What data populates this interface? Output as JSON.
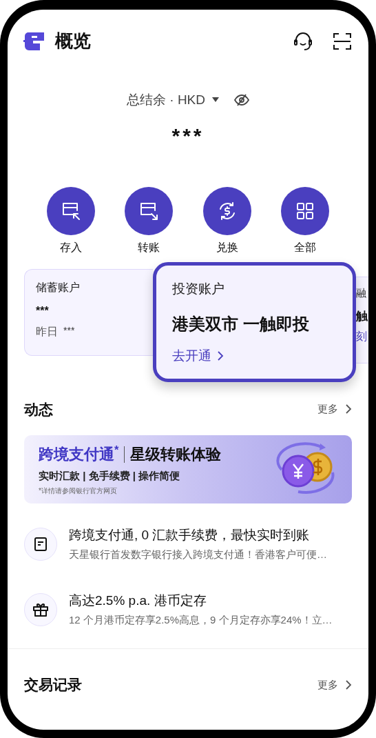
{
  "header": {
    "title": "概览"
  },
  "balance": {
    "label": "总结余 · HKD",
    "amount": "***",
    "hidden": true
  },
  "actions": [
    {
      "label": "存入",
      "kind": "deposit"
    },
    {
      "label": "转账",
      "kind": "transfer"
    },
    {
      "label": "兑换",
      "kind": "exchange"
    },
    {
      "label": "全部",
      "kind": "all"
    }
  ],
  "accounts": [
    {
      "title": "储蓄账户",
      "amount": "***",
      "yesterday_label": "昨日",
      "yesterday": "***"
    },
    {
      "title": "融",
      "line2": "触",
      "line3": "刻"
    }
  ],
  "popup_card": {
    "title": "投资账户",
    "headline": "港美双市 一触即投",
    "link": "去开通"
  },
  "feed": {
    "title": "动态",
    "more": "更多",
    "banner": {
      "title": "跨境支付通$^{*}$",
      "title2": "星级转账体验",
      "subtitle": "实时汇款 | 免手续费 | 操作简便",
      "note": "*详情请参阅银行官方网页"
    },
    "items": [
      {
        "kind": "news",
        "title": "跨境支付通, 0 汇款手续费，最快实时到账",
        "text": "天星银行首发数字银行接入跨境支付通！香港客户可便…"
      },
      {
        "kind": "gift",
        "title": "高达2.5% p.a. 港币定存",
        "text": "12 个月港币定存享2.5%高息，9 个月定存亦享24%！立…"
      }
    ]
  },
  "transactions": {
    "title": "交易记录",
    "more": "更多"
  }
}
